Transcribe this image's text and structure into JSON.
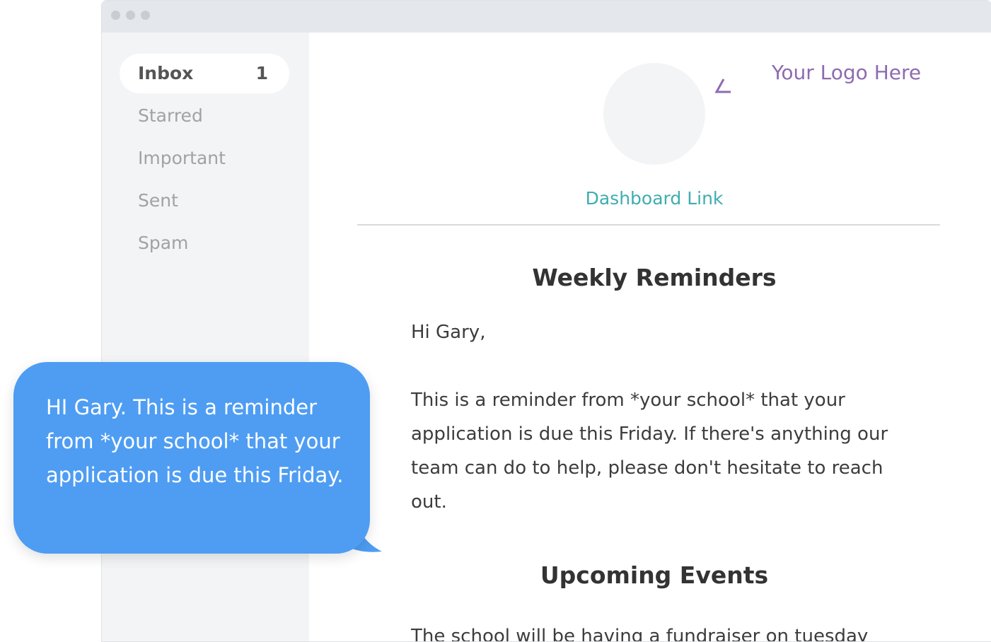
{
  "sidebar": {
    "items": [
      {
        "label": "Inbox",
        "count": "1",
        "active": true
      },
      {
        "label": "Starred"
      },
      {
        "label": "Important"
      },
      {
        "label": "Sent"
      },
      {
        "label": "Spam"
      }
    ]
  },
  "email": {
    "logo_text": "Your Logo Here",
    "dashboard_link": "Dashboard Link",
    "heading_1": "Weekly Reminders",
    "greeting": "Hi Gary,",
    "paragraph_1": "This is a reminder from *your school* that your application is due this Friday. If there's anything our team can do to help, please don't hesitate to reach out.",
    "heading_2": "Upcoming Events",
    "paragraph_2": "The school will be having a fundraiser on tuesday"
  },
  "sms": {
    "text": "HI Gary. This is a reminder from *your school* that your application is due this Friday."
  },
  "colors": {
    "accent_purple": "#8e6bb0",
    "link_teal": "#3fadb1",
    "bubble_blue": "#4e9df3",
    "sidebar_bg": "#f3f4f6",
    "titlebar_bg": "#e4e7eb"
  },
  "icons": {
    "window_controls": "traffic-light-dots",
    "logo_pointer": "arrow-pointer-icon"
  }
}
